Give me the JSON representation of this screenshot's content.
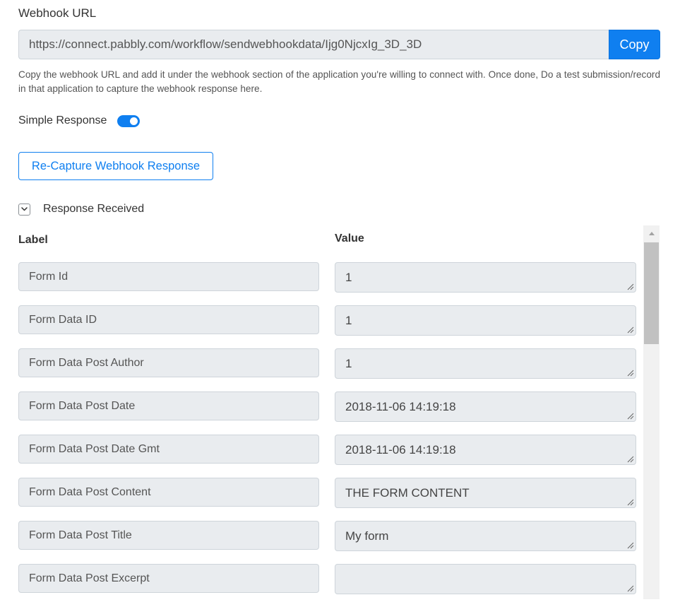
{
  "webhook": {
    "title": "Webhook URL",
    "url": "https://connect.pabbly.com/workflow/sendwebhookdata/Ijg0NjcxIg_3D_3D",
    "copy_label": "Copy",
    "help": "Copy the webhook URL and add it under the webhook section of the application you're willing to connect with. Once done, Do a test submission/record in that application to capture the webhook response here."
  },
  "simple_response": {
    "label": "Simple Response",
    "enabled": true
  },
  "recapture_label": "Re-Capture Webhook Response",
  "response": {
    "label": "Response Received",
    "expanded": true
  },
  "table": {
    "label_header": "Label",
    "value_header": "Value",
    "rows": [
      {
        "label": "Form Id",
        "value": "1"
      },
      {
        "label": "Form Data ID",
        "value": "1"
      },
      {
        "label": "Form Data Post Author",
        "value": "1"
      },
      {
        "label": "Form Data Post Date",
        "value": "2018-11-06 14:19:18"
      },
      {
        "label": "Form Data Post Date Gmt",
        "value": "2018-11-06 14:19:18"
      },
      {
        "label": "Form Data Post Content",
        "value": "THE FORM CONTENT"
      },
      {
        "label": "Form Data Post Title",
        "value": "My form"
      },
      {
        "label": "Form Data Post Excerpt",
        "value": ""
      }
    ]
  },
  "colors": {
    "accent": "#0f7ff0",
    "field_bg": "#e9ecef",
    "field_border": "#ced4da"
  },
  "icons": {
    "collapse": "chevron-down-icon",
    "resize": "resize-grip-icon",
    "scroll_up": "triangle-up-icon"
  }
}
